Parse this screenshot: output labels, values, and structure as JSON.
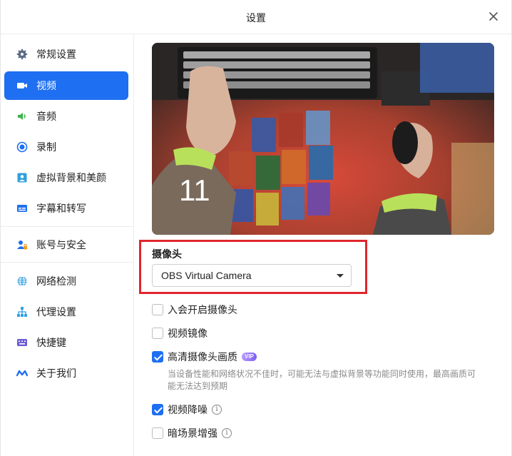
{
  "window": {
    "title": "设置"
  },
  "sidebar": {
    "items": [
      {
        "label": "常规设置",
        "icon": "gear-icon"
      },
      {
        "label": "视频",
        "icon": "video-icon",
        "active": true
      },
      {
        "label": "音频",
        "icon": "speaker-icon"
      },
      {
        "label": "录制",
        "icon": "record-icon"
      },
      {
        "label": "虚拟背景和美颜",
        "icon": "portrait-icon"
      },
      {
        "label": "字幕和转写",
        "icon": "subtitle-icon"
      },
      {
        "label": "账号与安全",
        "icon": "user-lock-icon"
      },
      {
        "label": "网络检测",
        "icon": "globe-icon"
      },
      {
        "label": "代理设置",
        "icon": "network-icon"
      },
      {
        "label": "快捷键",
        "icon": "keyboard-icon"
      },
      {
        "label": "关于我们",
        "icon": "logo-icon"
      }
    ]
  },
  "preview": {
    "overlay_number": "11"
  },
  "camera": {
    "label": "摄像头",
    "selected": "OBS Virtual Camera"
  },
  "options": [
    {
      "label": "入会开启摄像头",
      "checked": false
    },
    {
      "label": "视频镜像",
      "checked": false
    },
    {
      "label": "高清摄像头画质",
      "checked": true,
      "badge": "VIP"
    },
    {
      "label": "视频降噪",
      "checked": true,
      "info": true
    },
    {
      "label": "暗场景增强",
      "checked": false,
      "info": true
    }
  ],
  "hd_hint": "当设备性能和网络状况不佳时，可能无法与虚拟背景等功能同时使用，最高画质可能无法达到预期",
  "colors": {
    "accent": "#1e6ff1",
    "highlight_box": "#e0262c"
  }
}
